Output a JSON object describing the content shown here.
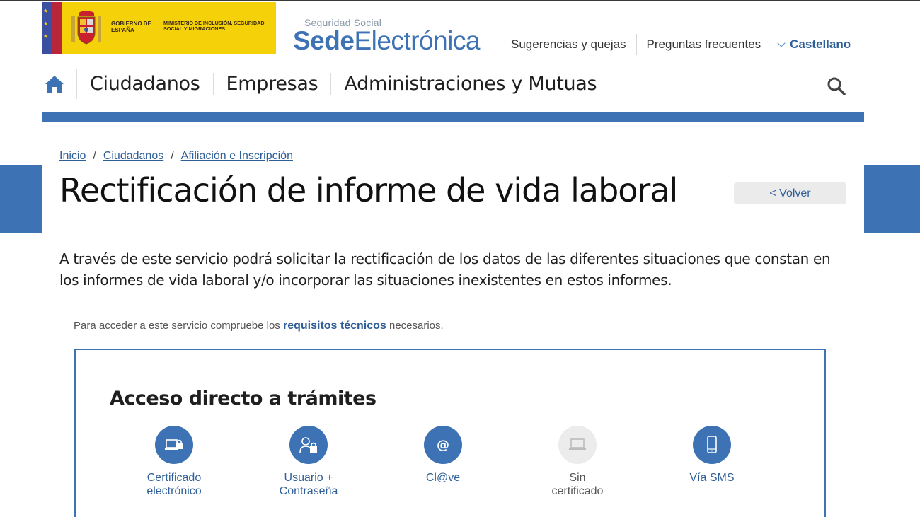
{
  "header": {
    "gov_text_line1": "GOBIERNO DE ESPAÑA",
    "gov_text_line2": "MINISTERIO DE INCLUSIÓN, SEGURIDAD SOCIAL Y MIGRACIONES",
    "brand_small": "Seguridad Social",
    "brand_bold": "Sede",
    "brand_light": "Electrónica",
    "links": [
      "Sugerencias y quejas",
      "Preguntas frecuentes"
    ],
    "language": "Castellano"
  },
  "nav": {
    "items": [
      "Ciudadanos",
      "Empresas",
      "Administraciones y Mutuas"
    ]
  },
  "breadcrumb": {
    "items": [
      "Inicio",
      "Ciudadanos",
      "Afiliación e Inscripción"
    ],
    "separator": "/"
  },
  "page": {
    "title": "Rectificación de informe de vida laboral",
    "back_label": "< Volver",
    "intro": "A través de este servicio podrá solicitar la rectificación de los datos de las diferentes situaciones que constan en los informes de vida laboral y/o incorporar las situaciones inexistentes en estos informes.",
    "req_prefix": "Para acceder a este servicio compruebe los",
    "req_link": "requisitos técnicos",
    "req_suffix": "necesarios."
  },
  "access": {
    "title": "Acceso directo a trámites",
    "options": [
      {
        "line1": "Certificado",
        "line2": "electrónico",
        "icon": "certificate-laptop-icon"
      },
      {
        "line1": "Usuario +",
        "line2": "Contraseña",
        "icon": "user-lock-icon"
      },
      {
        "line1": "Cl@ve",
        "line2": "",
        "icon": "at-sign-icon"
      },
      {
        "line1": "Sin",
        "line2": "certificado",
        "icon": "laptop-icon"
      },
      {
        "line1": "Vía SMS",
        "line2": "",
        "icon": "mobile-phone-icon"
      }
    ]
  },
  "colors": {
    "brand_blue": "#3d72b4",
    "gov_yellow": "#f5d10a",
    "link_blue": "#2f5f98"
  }
}
